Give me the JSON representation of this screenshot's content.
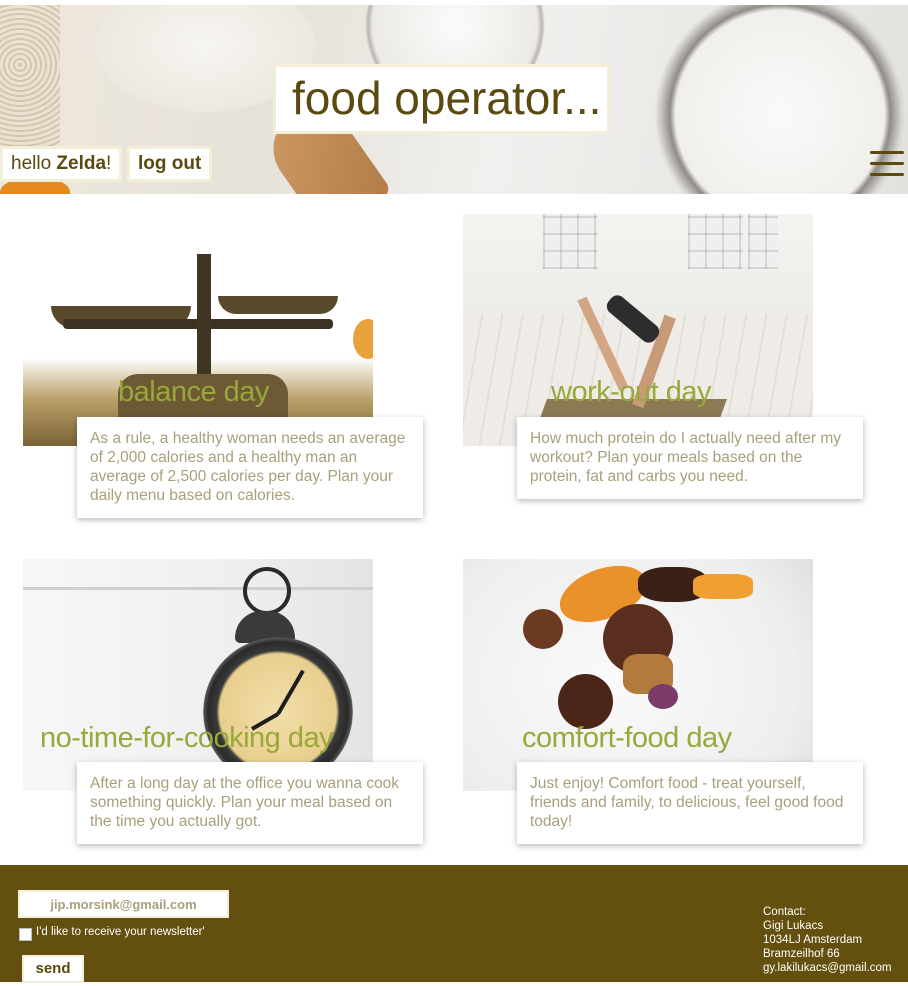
{
  "header": {
    "site_title": "food operator...",
    "greeting_prefix": "hello ",
    "user_name": "Zelda",
    "greeting_suffix": "!",
    "logout_label": "log out",
    "menu_icon": "hamburger-menu-icon"
  },
  "cards": [
    {
      "title": "balance day",
      "description": "As a rule, a healthy woman needs an average of 2,000 calories and a healthy man an average of 2,500 calories per day. Plan your daily menu based on calories."
    },
    {
      "title": "work-out day",
      "description": "How much protein do I actually need after my workout? Plan your meals based on the protein, fat and carbs you need."
    },
    {
      "title": "no-time-for-cooking day",
      "description": "After a long day at the office you wanna cook something quickly. Plan your meal based on the time you actually got."
    },
    {
      "title": "comfort-food day",
      "description": "Just enjoy! Comfort food - treat yourself, friends and family, to delicious, feel good food today!"
    }
  ],
  "footer": {
    "email_value": "jip.morsink@gmail.com",
    "newsletter_label": "I'd like to receive your newsletter'",
    "send_label": "send",
    "contact": {
      "heading": "Contact:",
      "name": "Gigi Lukacs",
      "postcode_city": "1034LJ Amsterdam",
      "street": "Bramzeilhof 66",
      "email": "gy.lakilukacs@gmail.com"
    }
  },
  "colors": {
    "brand_brown": "#634f0e",
    "title_text": "#5b4a0f",
    "card_title_green": "#98a83a",
    "description_text": "#a8a07a"
  }
}
